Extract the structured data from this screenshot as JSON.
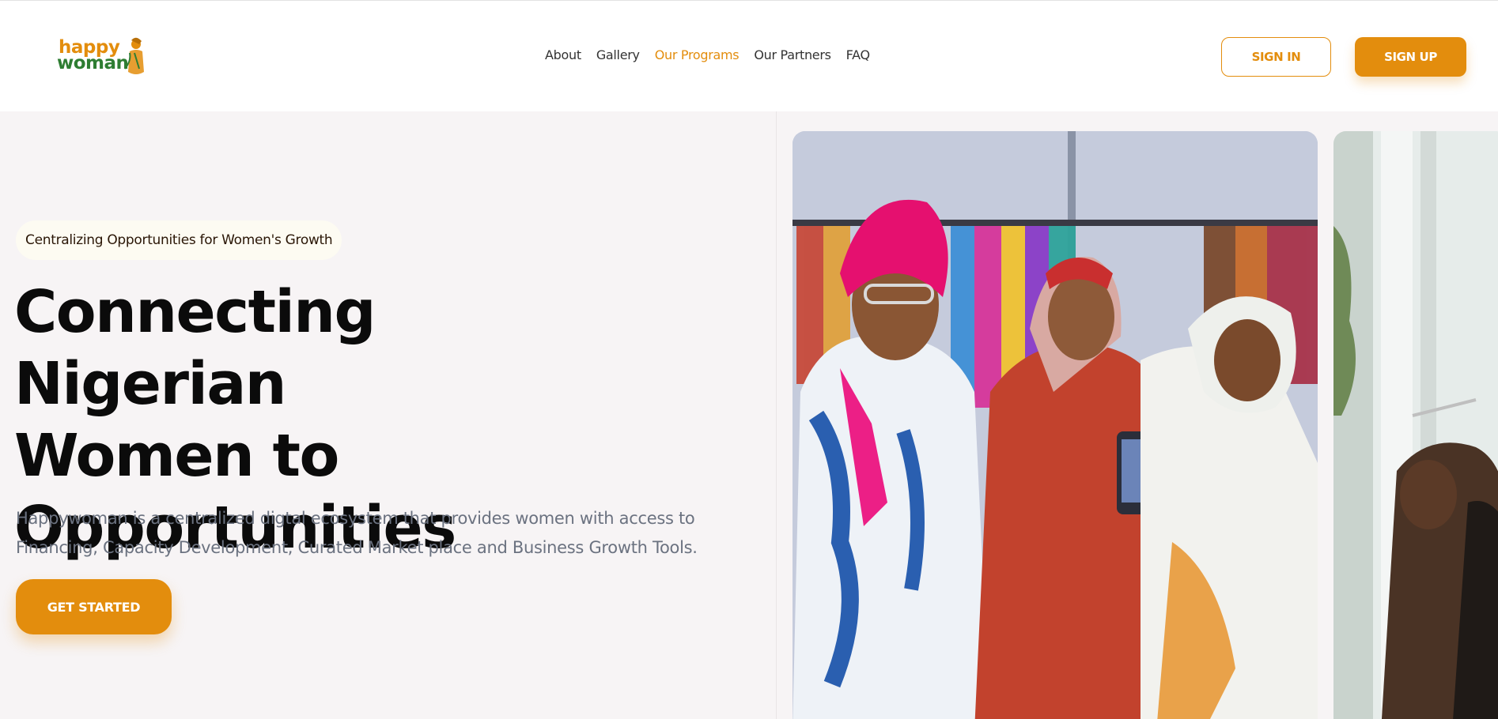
{
  "brand": {
    "logo_line1": "happy",
    "logo_line2": "woman",
    "accent_color": "#e38d0d",
    "logo_green": "#2e7d32"
  },
  "nav": {
    "items": [
      {
        "label": "About",
        "active": false
      },
      {
        "label": "Gallery",
        "active": false
      },
      {
        "label": "Our Programs",
        "active": true
      },
      {
        "label": "Our Partners",
        "active": false
      },
      {
        "label": "FAQ",
        "active": false
      }
    ]
  },
  "auth": {
    "sign_in_label": "SIGN IN",
    "sign_up_label": "SIGN UP"
  },
  "hero": {
    "badge": "Centralizing Opportunities for Women's Growth",
    "headline_line1": "Connecting Nigerian",
    "headline_line2": "Women to",
    "headline_line3": "Opportunities",
    "subtext_line1": "Happywoman is a centralized digtal ecosystem that provides women with access to",
    "subtext_line2": "Financing, Capacity Development, Curated Market place and Business Growth Tools.",
    "cta_label": "GET STARTED"
  },
  "gallery": {
    "images": [
      {
        "name": "three-women-boutique-photo"
      },
      {
        "name": "woman-with-pen-photo"
      }
    ]
  }
}
